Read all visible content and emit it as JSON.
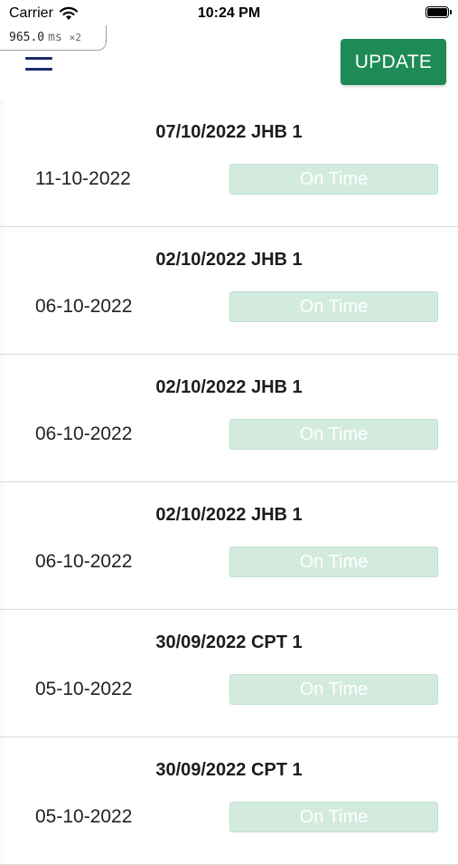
{
  "status_bar": {
    "carrier": "Carrier",
    "time": "10:24 PM"
  },
  "perf_overlay": {
    "value": "965.0",
    "unit": "ms",
    "multiplier": "×2"
  },
  "header": {
    "update_label": "UPDATE"
  },
  "colors": {
    "accent": "#1e8a55",
    "status_bg": "#d3ebdf",
    "menu": "#1b2a6b"
  },
  "items": [
    {
      "title": "07/10/2022 JHB 1",
      "date": "11-10-2022",
      "status": "On Time"
    },
    {
      "title": "02/10/2022 JHB 1",
      "date": "06-10-2022",
      "status": "On Time"
    },
    {
      "title": "02/10/2022 JHB 1",
      "date": "06-10-2022",
      "status": "On Time"
    },
    {
      "title": "02/10/2022 JHB 1",
      "date": "06-10-2022",
      "status": "On Time"
    },
    {
      "title": "30/09/2022 CPT 1",
      "date": "05-10-2022",
      "status": "On Time"
    },
    {
      "title": "30/09/2022 CPT 1",
      "date": "05-10-2022",
      "status": "On Time"
    }
  ]
}
